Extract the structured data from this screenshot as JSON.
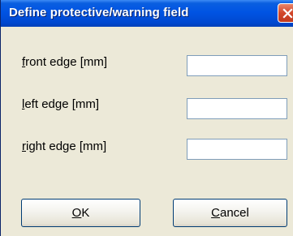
{
  "window": {
    "title": "Define protective/warning field",
    "close_label": "close"
  },
  "fields": [
    {
      "label_mnemonic": "f",
      "label_rest": "ront edge [mm]",
      "value": ""
    },
    {
      "label_mnemonic": "l",
      "label_rest": "eft edge [mm]",
      "value": ""
    },
    {
      "label_mnemonic": "r",
      "label_rest": "ight edge [mm]",
      "value": ""
    }
  ],
  "buttons": {
    "ok": {
      "mnemonic": "O",
      "rest": "K"
    },
    "cancel": {
      "mnemonic": "C",
      "rest": "ancel"
    }
  },
  "colors": {
    "titlebar": "#0054e3",
    "dialog_background": "#ece9d8",
    "close_button": "#d2472a",
    "input_border": "#7f9db9"
  },
  "icons": {
    "close": "close-icon"
  }
}
